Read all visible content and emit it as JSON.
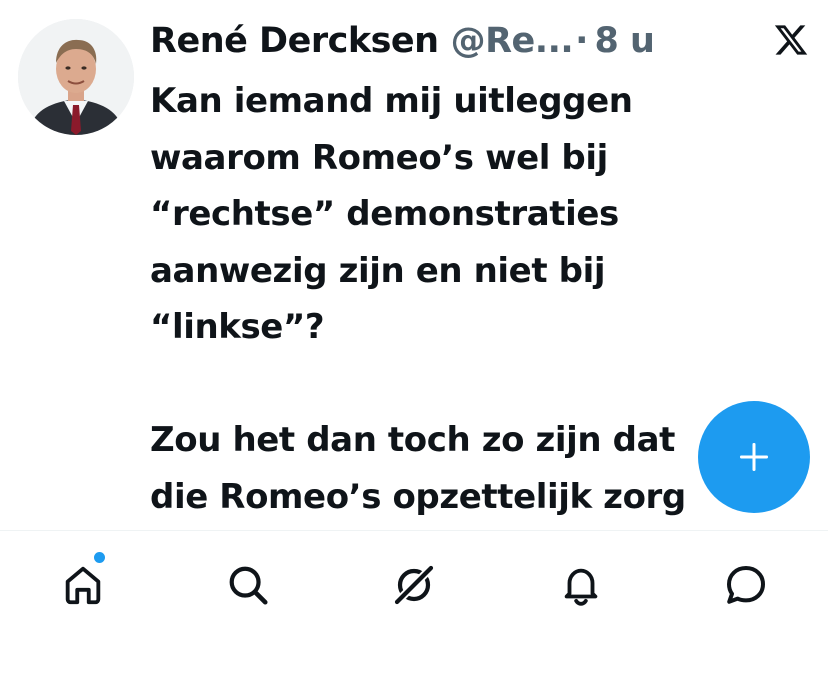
{
  "tweet": {
    "display_name": "René Dercksen",
    "handle": "@Re...",
    "separator": "·",
    "time": "8 u",
    "body_lines": [
      "Kan iemand mij uitleggen",
      "waarom Romeo’s wel bij",
      "“rechtse” demonstraties",
      "aanwezig zijn en niet bij",
      "“linkse”?",
      "",
      "Zou het dan toch zo zijn dat",
      "die Romeo’s opzettelijk zorg"
    ]
  },
  "compose_button": {
    "symbol": "+"
  },
  "bottom_nav": {
    "items": [
      {
        "icon": "home-icon",
        "active": true,
        "has_notification_dot": true
      },
      {
        "icon": "search-icon",
        "active": false
      },
      {
        "icon": "grok-icon",
        "active": false
      },
      {
        "icon": "bell-icon",
        "active": false
      },
      {
        "icon": "messages-icon",
        "active": false
      }
    ]
  },
  "colors": {
    "accent": "#1d9bf0",
    "text_primary": "#0f1419",
    "text_secondary": "#536471"
  }
}
